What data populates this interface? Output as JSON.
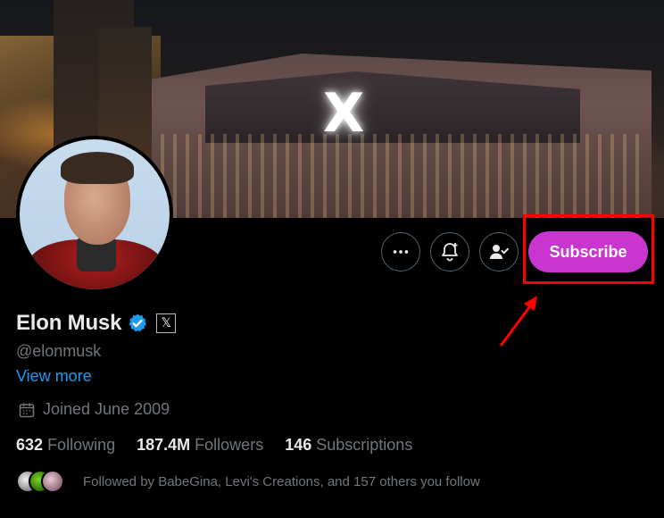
{
  "banner": {
    "sign_text": "X"
  },
  "actions": {
    "more_icon": "more-horizontal-icon",
    "notify_icon": "bell-plus-icon",
    "following_icon": "user-check-icon",
    "subscribe_label": "Subscribe"
  },
  "profile": {
    "name": "Elon Musk",
    "affiliation_badge": "𝕏",
    "handle": "@elonmusk",
    "view_more": "View more",
    "joined": "Joined June 2009"
  },
  "stats": {
    "following_count": "632",
    "following_label": "Following",
    "followers_count": "187.4M",
    "followers_label": "Followers",
    "subscriptions_count": "146",
    "subscriptions_label": "Subscriptions"
  },
  "followed_by": {
    "text": "Followed by BabeGina, Levi's Creations, and 157 others you follow"
  },
  "colors": {
    "background": "#000000",
    "subscribe": "#c936cf",
    "link": "#1d9bf0",
    "verified": "#1d9bf0",
    "highlight": "#ff0000",
    "muted_text": "#71767b"
  }
}
